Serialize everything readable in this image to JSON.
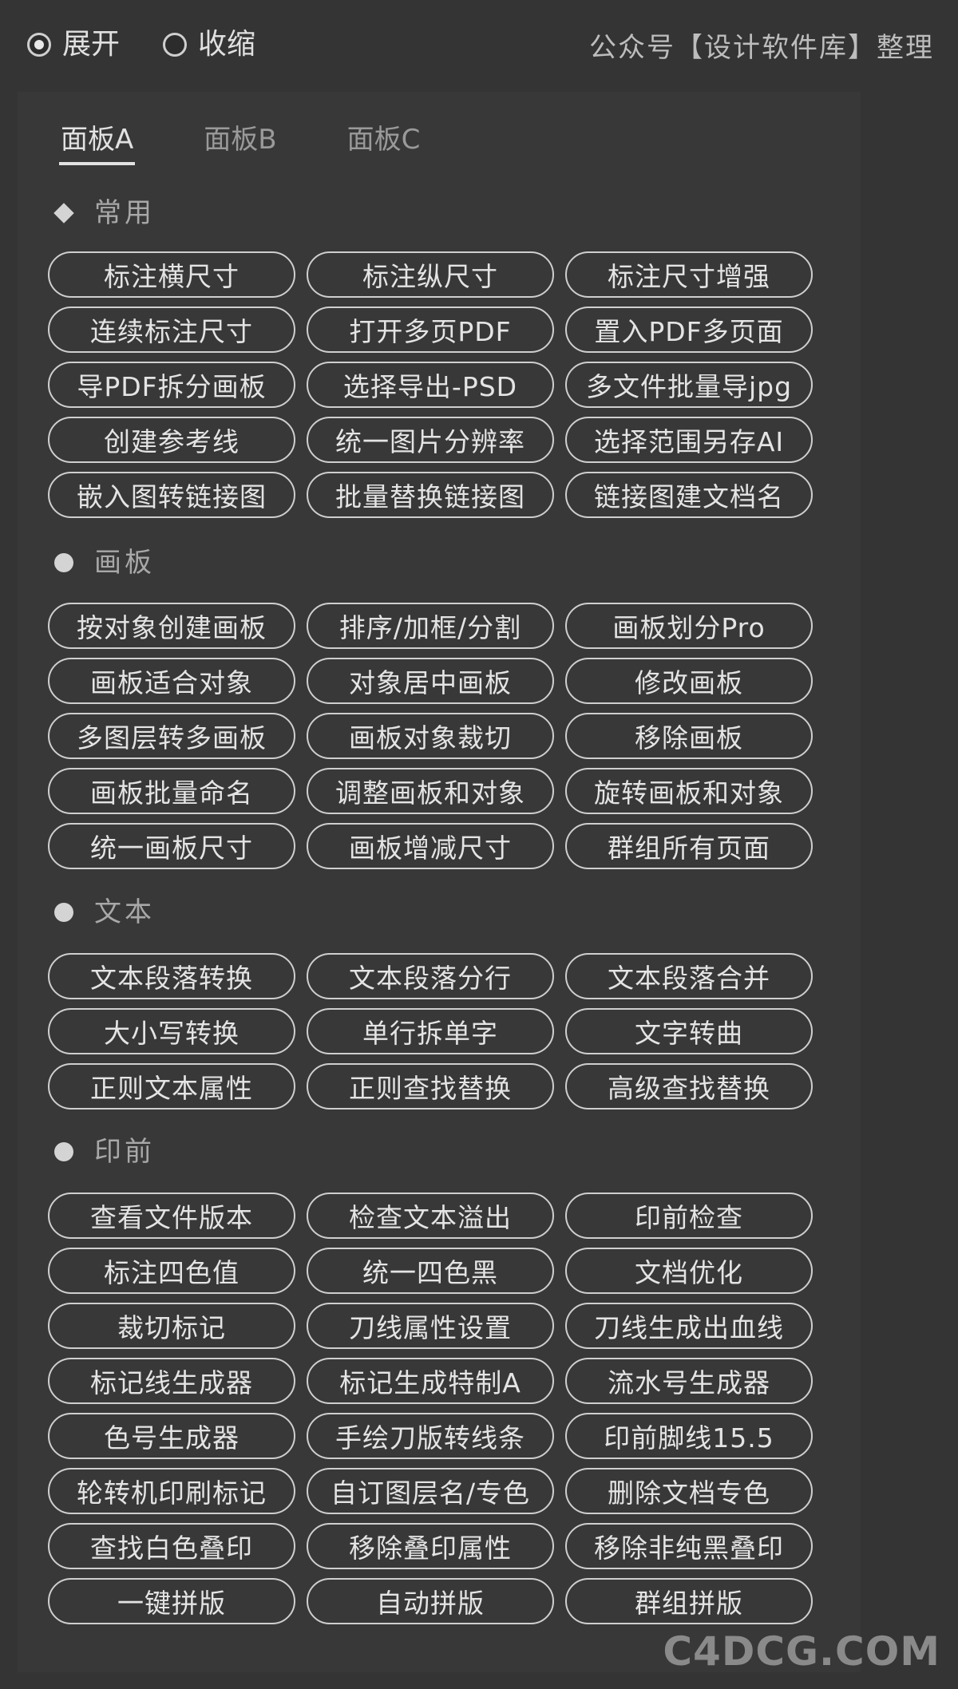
{
  "top": {
    "expand_label": "展开",
    "collapse_label": "收缩",
    "selected": "展开",
    "credit": "公众号【设计软件库】整理"
  },
  "tabs": [
    "面板A",
    "面板B",
    "面板C"
  ],
  "active_tab": "面板A",
  "sections": [
    {
      "title": "常用",
      "marker": "diamond",
      "buttons": [
        "标注横尺寸",
        "标注纵尺寸",
        "标注尺寸增强",
        "连续标注尺寸",
        "打开多页PDF",
        "置入PDF多页面",
        "导PDF拆分画板",
        "选择导出-PSD",
        "多文件批量导jpg",
        "创建参考线",
        "统一图片分辨率",
        "选择范围另存AI",
        "嵌入图转链接图",
        "批量替换链接图",
        "链接图建文档名"
      ]
    },
    {
      "title": "画板",
      "marker": "dot",
      "buttons": [
        "按对象创建画板",
        "排序/加框/分割",
        "画板划分Pro",
        "画板适合对象",
        "对象居中画板",
        "修改画板",
        "多图层转多画板",
        "画板对象裁切",
        "移除画板",
        "画板批量命名",
        "调整画板和对象",
        "旋转画板和对象",
        "统一画板尺寸",
        "画板增减尺寸",
        "群组所有页面"
      ]
    },
    {
      "title": "文本",
      "marker": "dot",
      "buttons": [
        "文本段落转换",
        "文本段落分行",
        "文本段落合并",
        "大小写转换",
        "单行拆单字",
        "文字转曲",
        "正则文本属性",
        "正则查找替换",
        "高级查找替换"
      ]
    },
    {
      "title": "印前",
      "marker": "dot",
      "buttons": [
        "查看文件版本",
        "检查文本溢出",
        "印前检查",
        "标注四色值",
        "统一四色黑",
        "文档优化",
        "裁切标记",
        "刀线属性设置",
        "刀线生成出血线",
        "标记线生成器",
        "标记生成特制A",
        "流水号生成器",
        "色号生成器",
        "手绘刀版转线条",
        "印前脚线15.5",
        "轮转机印刷标记",
        "自订图层名/专色",
        "删除文档专色",
        "查找白色叠印",
        "移除叠印属性",
        "移除非纯黑叠印",
        "一键拼版",
        "自动拼版",
        "群组拼版"
      ]
    }
  ],
  "watermark": "C4DCG.COM"
}
